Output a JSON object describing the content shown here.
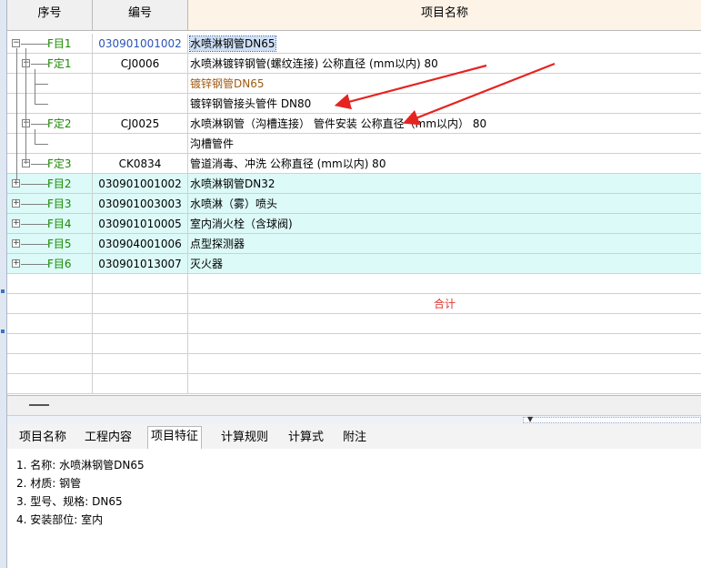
{
  "header": {
    "seq": "序号",
    "code": "编号",
    "name": "项目名称"
  },
  "rows": [
    {
      "seq": "F目1",
      "code": "030901001002",
      "name": "水喷淋钢管DN65"
    },
    {
      "seq": "F定1",
      "code": "CJ0006",
      "name": "水喷淋镀锌钢管(螺纹连接) 公称直径 (mm以内) 80"
    },
    {
      "seq": "",
      "code": "",
      "name": "镀锌钢管DN65"
    },
    {
      "seq": "",
      "code": "",
      "name": "镀锌钢管接头管件 DN80"
    },
    {
      "seq": "F定2",
      "code": "CJ0025",
      "name": "水喷淋钢管（沟槽连接） 管件安装 公称直径（mm以内） 80"
    },
    {
      "seq": "",
      "code": "",
      "name": "沟槽管件"
    },
    {
      "seq": "F定3",
      "code": "CK0834",
      "name": "管道消毒、冲洗 公称直径 (mm以内) 80"
    },
    {
      "seq": "F目2",
      "code": "030901001002",
      "name": "水喷淋钢管DN32"
    },
    {
      "seq": "F目3",
      "code": "030901003003",
      "name": "水喷淋（雾）喷头"
    },
    {
      "seq": "F目4",
      "code": "030901010005",
      "name": "室内消火栓（含球阀)"
    },
    {
      "seq": "F目5",
      "code": "030904001006",
      "name": "点型探测器"
    },
    {
      "seq": "F目6",
      "code": "030901013007",
      "name": "灭火器"
    }
  ],
  "total_label": "合计",
  "tabs": [
    "项目名称",
    "工程内容",
    "项目特征",
    "计算规则",
    "计算式",
    "附注"
  ],
  "active_tab": "项目特征",
  "features": [
    "1. 名称: 水喷淋钢管DN65",
    "2. 材质: 钢管",
    "3. 型号、规格: DN65",
    "4. 安装部位: 室内"
  ],
  "colors": {
    "fixed_green": "#1a8a00",
    "code_blue": "#2a55b7",
    "total_red": "#e0312d",
    "arrow_red": "#e52421",
    "cyan_row": "#dcfaf8"
  }
}
